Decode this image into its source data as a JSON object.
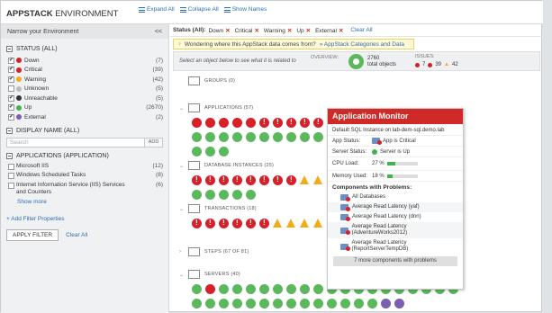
{
  "header": {
    "title_bold": "APPSTACK",
    "title_rest": " ENVIRONMENT",
    "expand_all": "Expand All",
    "collapse_all": "Collapse All",
    "show_names": "Show Names"
  },
  "sidebar": {
    "title": "Narrow your Environment",
    "collapse_glyph": "<<",
    "status_section": "STATUS (ALL)",
    "statuses": [
      {
        "label": "Down",
        "count": "(7)",
        "checked": true,
        "color": "#d6202a"
      },
      {
        "label": "Critical",
        "count": "(39)",
        "checked": true,
        "color": "#d6202a"
      },
      {
        "label": "Warning",
        "count": "(42)",
        "checked": true,
        "color": "#f0ad1b"
      },
      {
        "label": "Unknown",
        "count": "(5)",
        "checked": false,
        "color": "#b9bdc1"
      },
      {
        "label": "Unreachable",
        "count": "(5)",
        "checked": true,
        "color": "#333333"
      },
      {
        "label": "Up",
        "count": "(2670)",
        "checked": true,
        "color": "#41b34b"
      },
      {
        "label": "External",
        "count": "(2)",
        "checked": true,
        "color": "#7a5fb0"
      }
    ],
    "display_section": "DISPLAY NAME (ALL)",
    "search_placeholder": "Search",
    "add_label": "ADD",
    "apps_section": "APPLICATIONS (APPLICATION)",
    "apps": [
      {
        "label": "Microsoft IIS",
        "count": "(12)"
      },
      {
        "label": "Windows Scheduled Tasks",
        "count": "(8)"
      },
      {
        "label": "Internet Information Service (IIS) Services and Counters",
        "count": "(6)"
      }
    ],
    "show_more": "Show more",
    "add_filter": "+ Add Filter Properties",
    "apply": "APPLY FILTER",
    "clear": "Clear All"
  },
  "main": {
    "status_label": "Status (All):",
    "chips": [
      "Down",
      "Critical",
      "Warning",
      "Up",
      "External"
    ],
    "clear_all": "Clear All",
    "banner_text": "Wondering where this AppStack data comes from?",
    "banner_link": "» AppStack Categories and Data",
    "select_hint": "Select an object below to see what it is related to",
    "overview_label": "OVERVIEW:",
    "total_num": "2760",
    "total_label": "total objects",
    "issues_label": "ISSUES:",
    "issue_counts": [
      "7",
      "39",
      "42"
    ],
    "groups": [
      {
        "label": "GROUPS (0)"
      },
      {
        "label": "APPLICATIONS (57)"
      },
      {
        "label": "DATABASE INSTANCES (25)"
      },
      {
        "label": "TRANSACTIONS (18)"
      },
      {
        "label": "STEPS (67 OF 81)"
      },
      {
        "label": "SERVERS (40)"
      }
    ]
  },
  "tooltip": {
    "title": "Application Monitor",
    "subtitle": "Default SQL Instance on lab-dem-sql.demo.lab",
    "app_status_k": "App Status:",
    "app_status_v": "App is Critical",
    "server_status_k": "Server Status:",
    "server_status_v": "Server is Up",
    "cpu_k": "CPU Load:",
    "cpu_v": "27 %",
    "cpu_pct": 27,
    "mem_k": "Memory Used:",
    "mem_v": "18 %",
    "mem_pct": 18,
    "components_title": "Components with Problems:",
    "components": [
      "All Databases",
      "Average Read Latency (yaf)",
      "Average Read Latency (dnn)",
      "Average Read Latency (AdventureWorks2012)",
      "Average Read Latency (ReportServerTempDB)"
    ],
    "more": "7 more components with problems"
  }
}
